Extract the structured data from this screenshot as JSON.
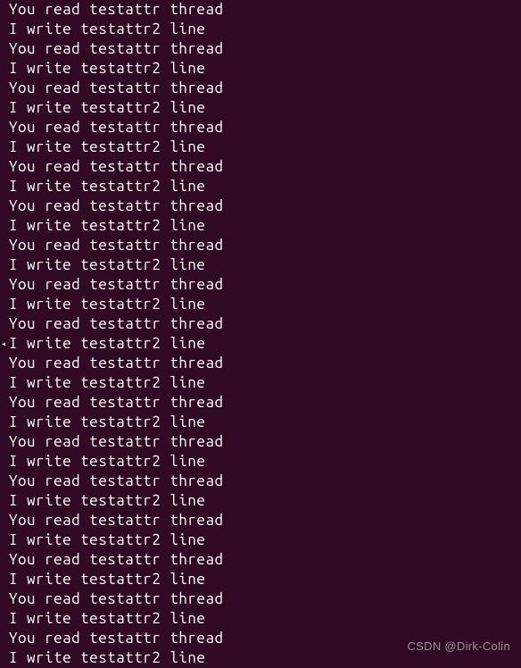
{
  "terminal": {
    "lines": [
      "You read testattr thread",
      "I write testattr2 line",
      "You read testattr thread",
      "I write testattr2 line",
      "You read testattr thread",
      "I write testattr2 line",
      "You read testattr thread",
      "I write testattr2 line",
      "You read testattr thread",
      "I write testattr2 line",
      "You read testattr thread",
      "I write testattr2 line",
      "You read testattr thread",
      "I write testattr2 line",
      "You read testattr thread",
      "I write testattr2 line",
      "You read testattr thread",
      "I write testattr2 line",
      "You read testattr thread",
      "I write testattr2 line",
      "You read testattr thread",
      "I write testattr2 line",
      "You read testattr thread",
      "I write testattr2 line",
      "You read testattr thread",
      "I write testattr2 line",
      "You read testattr thread",
      "I write testattr2 line",
      "You read testattr thread",
      "I write testattr2 line",
      "You read testattr thread",
      "I write testattr2 line",
      "You read testattr thread",
      "I write testattr2 line"
    ],
    "indicator_row": 17,
    "indicator_glyph": "◂"
  },
  "watermark": "CSDN @Dirk-Colin"
}
